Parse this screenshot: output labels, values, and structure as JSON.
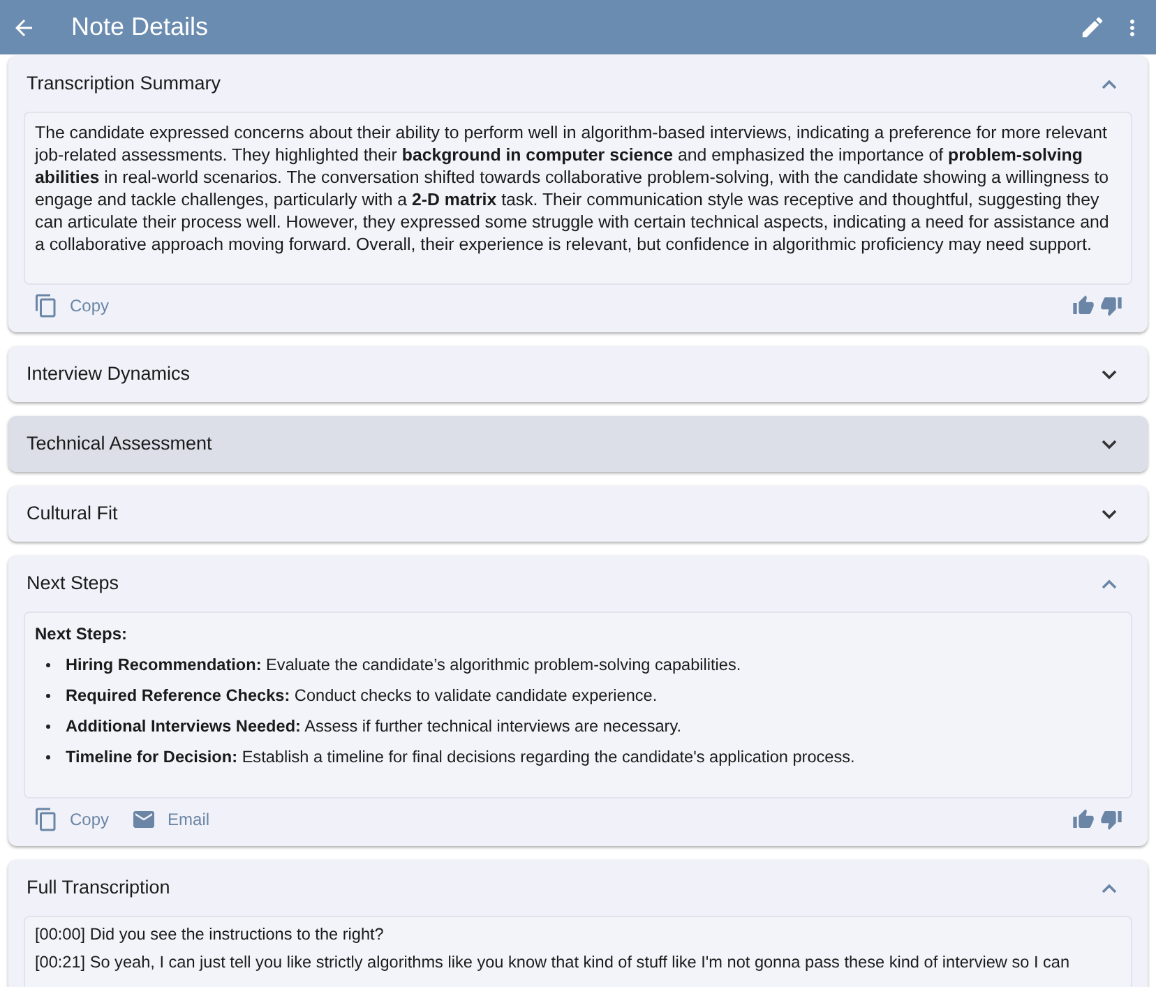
{
  "app_bar": {
    "title": "Note Details"
  },
  "sections": [
    {
      "kind": "paragraph",
      "title": "Transcription Summary",
      "expanded": true,
      "highlighted": false,
      "text": "The candidate expressed concerns about their ability to perform well in algorithm-based interviews, indicating a preference for more relevant job-related assessments. They highlighted their **background in computer science** and emphasized the importance of **problem-solving abilities** in real-world scenarios. The conversation shifted towards collaborative problem-solving, with the candidate showing a willingness to engage and tackle challenges, particularly with a **2-D matrix** task. Their communication style was receptive and thoughtful, suggesting they can articulate their process well. However, they expressed some struggle with certain technical aspects, indicating a need for assistance and a collaborative approach moving forward. Overall, their experience is relevant, but confidence in algorithmic proficiency may need support.",
      "actions": [
        {
          "kind": "copy",
          "label": "Copy"
        }
      ]
    },
    {
      "title": "Interview Dynamics",
      "expanded": false,
      "highlighted": false
    },
    {
      "title": "Technical Assessment",
      "expanded": false,
      "highlighted": true
    },
    {
      "title": "Cultural Fit",
      "expanded": false,
      "highlighted": false
    },
    {
      "kind": "list",
      "title": "Next Steps",
      "expanded": true,
      "highlighted": false,
      "heading": "Next Steps:",
      "items": [
        {
          "term": "Hiring Recommendation:",
          "text": "Evaluate the candidate’s algorithmic problem-solving capabilities."
        },
        {
          "term": "Required Reference Checks:",
          "text": "Conduct checks to validate candidate experience."
        },
        {
          "term": "Additional Interviews Needed:",
          "text": "Assess if further technical interviews are necessary."
        },
        {
          "term": "Timeline for Decision:",
          "text": "Establish a timeline for final decisions regarding the candidate's application process."
        }
      ],
      "actions": [
        {
          "kind": "copy",
          "label": "Copy"
        },
        {
          "kind": "email",
          "label": "Email"
        }
      ]
    },
    {
      "kind": "transcript",
      "title": "Full Transcription",
      "expanded": true,
      "highlighted": false,
      "lines": [
        "[00:00] Did you see the instructions to the right?",
        "[00:21] So yeah, I can just tell you like strictly algorithms like you know that kind of stuff like I'm not gonna pass these kind of interview so I can"
      ]
    }
  ]
}
